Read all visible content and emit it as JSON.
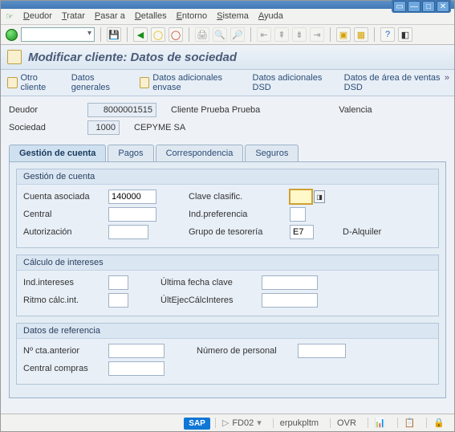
{
  "menu": {
    "deudor": "Deudor",
    "tratar": "Tratar",
    "pasar": "Pasar a",
    "detalles": "Detalles",
    "entorno": "Entorno",
    "sistema": "Sistema",
    "ayuda": "Ayuda"
  },
  "page_title": "Modificar cliente: Datos de sociedad",
  "apptb": {
    "otro": "Otro cliente",
    "gen": "Datos generales",
    "env": "Datos adicionales envase",
    "dsd": "Datos adicionales DSD",
    "area": "Datos de área de ventas DSD"
  },
  "header": {
    "deudor_lbl": "Deudor",
    "deudor_val": "8000001515",
    "deudor_name": "Cliente Prueba Prueba",
    "deudor_city": "Valencia",
    "soc_lbl": "Sociedad",
    "soc_val": "1000",
    "soc_name": "CEPYME SA"
  },
  "tabs": {
    "t1": "Gestión de cuenta",
    "t2": "Pagos",
    "t3": "Correspondencia",
    "t4": "Seguros"
  },
  "grp1": {
    "title": "Gestión de cuenta",
    "cuenta_lbl": "Cuenta asociada",
    "cuenta_val": "140000",
    "clave_lbl": "Clave clasific.",
    "clave_val": "",
    "central_lbl": "Central",
    "indpref_lbl": "Ind.preferencia",
    "aut_lbl": "Autorización",
    "grteso_lbl": "Grupo de tesorería",
    "grteso_val": "E7",
    "grteso_text": "D-Alquiler"
  },
  "grp2": {
    "title": "Cálculo de intereses",
    "ind_lbl": "Ind.intereses",
    "ult_lbl": "Última fecha clave",
    "ritmo_lbl": "Ritmo cálc.int.",
    "ultej_lbl": "ÚltEjecCálcInteres"
  },
  "grp3": {
    "title": "Datos de referencia",
    "ncta_lbl": "Nº cta.anterior",
    "npers_lbl": "Número de personal",
    "centcomp_lbl": "Central compras"
  },
  "status": {
    "tcode": "FD02",
    "sys": "erpukpltm",
    "mode": "OVR",
    "sap": "SAP"
  }
}
